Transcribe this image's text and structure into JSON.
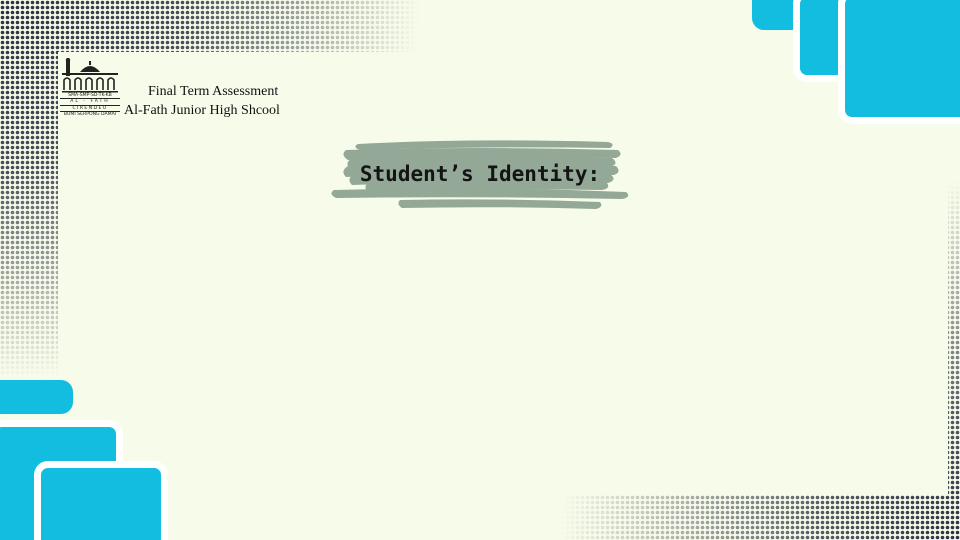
{
  "header": {
    "line1": "Final Term Assessment",
    "line2": "Al-Fath Junior High Shcool"
  },
  "logo": {
    "text_top": "SMA-SMP-SD-TK-KB",
    "text_mid": "AL - FATH",
    "text_bot1": "CIRENDEU",
    "text_bot2": "BUMI SERPONG DAMAI"
  },
  "title": {
    "label": "Student’s Identity:"
  },
  "colors": {
    "background": "#f6fbea",
    "accent_blue": "#13bde0",
    "brush_stroke": "#93a896",
    "dot_pattern": "#2b3140"
  }
}
